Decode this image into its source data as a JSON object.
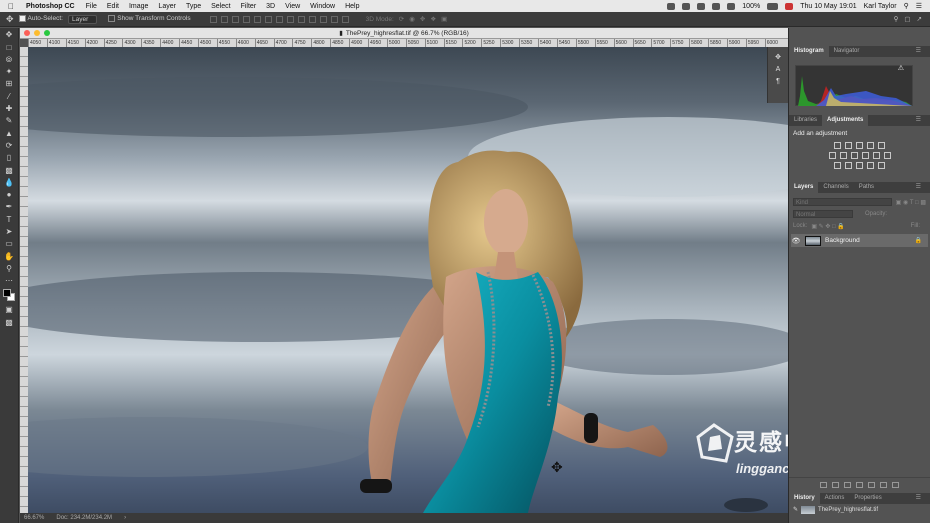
{
  "menubar": {
    "app": "Photoshop CC",
    "items": [
      "File",
      "Edit",
      "Image",
      "Layer",
      "Type",
      "Select",
      "Filter",
      "3D",
      "View",
      "Window",
      "Help"
    ],
    "battery": "100%",
    "datetime": "Thu 10 May 19:01",
    "user": "Karl Taylor"
  },
  "options": {
    "auto_select_label": "Auto-Select:",
    "auto_select_value": "Layer",
    "transform_label": "Show Transform Controls",
    "mode_3d": "3D Mode:"
  },
  "document": {
    "title": "ThePrey_highresflat.tif @ 66.7% (RGB/16)",
    "ruler_ticks": [
      "4050",
      "4100",
      "4150",
      "4200",
      "4250",
      "4300",
      "4350",
      "4400",
      "4450",
      "4500",
      "4550",
      "4600",
      "4650",
      "4700",
      "4750",
      "4800",
      "4850",
      "4900",
      "4950",
      "5000",
      "5050",
      "5100",
      "5150",
      "5200",
      "5250",
      "5300",
      "5350",
      "5400",
      "5450",
      "5500",
      "5550",
      "5600",
      "5650",
      "5700",
      "5750",
      "5800",
      "5850",
      "5900",
      "5950",
      "6000"
    ]
  },
  "status": {
    "zoom": "66.67%",
    "doc": "Doc: 234.2M/234.2M"
  },
  "panels": {
    "top_tabs": [
      "Histogram",
      "Navigator"
    ],
    "mid_tabs": [
      "Libraries",
      "Adjustments"
    ],
    "add_adjustment": "Add an adjustment",
    "layer_tabs": [
      "Layers",
      "Channels",
      "Paths"
    ],
    "filter_placeholder": "Kind",
    "blend_mode": "Normal",
    "opacity_label": "Opacity:",
    "lock_label": "Lock:",
    "fill_label": "Fill:",
    "layer_name": "Background",
    "bottom_tabs": [
      "History",
      "Actions",
      "Properties"
    ],
    "history_item": "ThePrey_highresflat.tif"
  },
  "watermark": {
    "title": "灵感中国",
    "url": "lingganchina.com"
  },
  "colors": {
    "accent": "#0a9fb5",
    "traffic_red": "#fc5f57",
    "traffic_yellow": "#fdbc2e",
    "traffic_green": "#28c840"
  }
}
